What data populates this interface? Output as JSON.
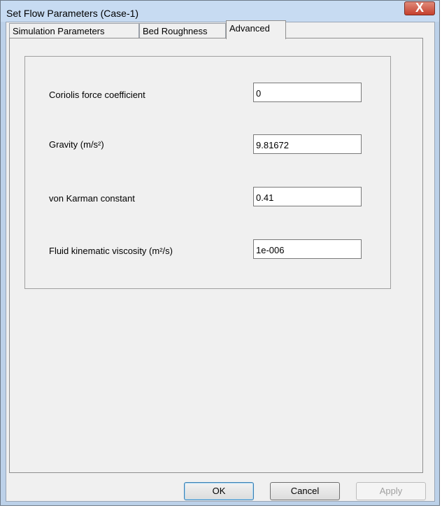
{
  "window": {
    "title": "Set Flow Parameters (Case-1)",
    "close_glyph": "X"
  },
  "tabs": [
    {
      "label": "Simulation Parameters",
      "active": false
    },
    {
      "label": "Bed Roughness",
      "active": false
    },
    {
      "label": "Advanced",
      "active": true
    }
  ],
  "fields": [
    {
      "label": "Coriolis force coefficient",
      "value": "0"
    },
    {
      "label": "Gravity (m/s²)",
      "value": "9.81672"
    },
    {
      "label": "von Karman constant",
      "value": "0.41"
    },
    {
      "label": "Fluid kinematic viscosity (m²/s)",
      "value": "1e-006"
    }
  ],
  "buttons": {
    "ok": "OK",
    "cancel": "Cancel",
    "apply": "Apply"
  }
}
